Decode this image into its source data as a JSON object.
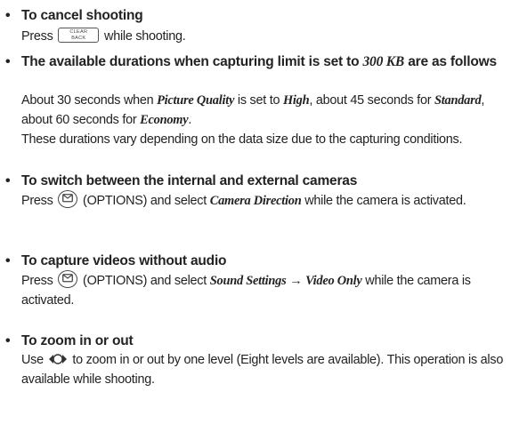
{
  "items": [
    {
      "heading": "To cancel shooting",
      "body": {
        "pre": "Press",
        "key_line1": "CLEAR",
        "key_line2": "BACK",
        "post": "while shooting."
      }
    },
    {
      "heading_pre": "The available durations when capturing limit is set to",
      "heading_em": "300 KB",
      "heading_post": "are as follows",
      "body": {
        "t1": "About 30 seconds when",
        "e1": "Picture Quality",
        "t2": "is set to",
        "e2": "High",
        "t3": ", about 45 seconds for",
        "e3": "Standard",
        "t4": ", about 60 seconds for",
        "e4": "Economy",
        "t5": ".",
        "t6": "These durations vary depending on the data size due to the capturing conditions."
      }
    },
    {
      "heading": "To switch between the internal and external cameras",
      "body": {
        "pre": "Press",
        "post1": "(OPTIONS) and select",
        "em": "Camera Direction",
        "post2": "while the camera is activated."
      }
    },
    {
      "heading": "To capture videos without audio",
      "body": {
        "pre": "Press",
        "post1": "(OPTIONS) and select",
        "em1": "Sound Settings",
        "arrow": "→",
        "em2": "Video Only",
        "post2": "while the camera is activated."
      }
    },
    {
      "heading": "To zoom in or out",
      "body": {
        "pre": "Use",
        "post": "to zoom in or out by one level (Eight levels are available). This operation is also available while shooting."
      }
    }
  ]
}
